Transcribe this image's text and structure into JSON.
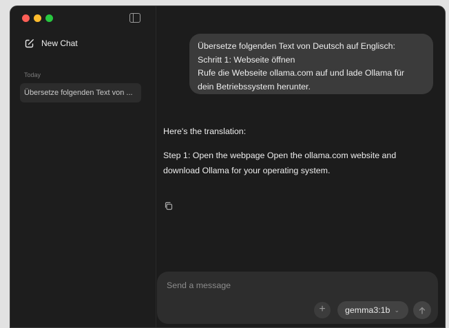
{
  "window": {
    "traffic_lights": {
      "close": "#fe5f57",
      "minimize": "#febc2e",
      "zoom": "#28c840"
    }
  },
  "sidebar": {
    "toggle_icon": "sidebar-toggle-icon",
    "new_chat_label": "New Chat",
    "new_chat_icon": "compose-icon",
    "section_label": "Today",
    "chats": [
      {
        "title": "Übersetze folgenden Text von ..."
      }
    ]
  },
  "conversation": {
    "user_message": {
      "lines": [
        "Übersetze folgenden Text von Deutsch auf Englisch:",
        "Schritt 1: Webseite öffnen",
        "Rufe die Webseite ollama.com auf und lade Ollama für",
        "dein Betriebssystem herunter."
      ]
    },
    "assistant_message": {
      "intro": "Here's the translation:",
      "body": "Step 1: Open the webpage Open the ollama.com website and download Ollama for your operating system.",
      "copy_icon": "copy-icon"
    }
  },
  "composer": {
    "placeholder": "Send a message",
    "value": "",
    "add_icon": "plus-icon",
    "model": "gemma3:1b",
    "send_icon": "arrow-up-icon"
  },
  "colors": {
    "window_bg": "#1c1c1c",
    "bubble_bg": "#3b3b3b",
    "composer_bg": "#2d2d2d",
    "text": "#ededed"
  }
}
